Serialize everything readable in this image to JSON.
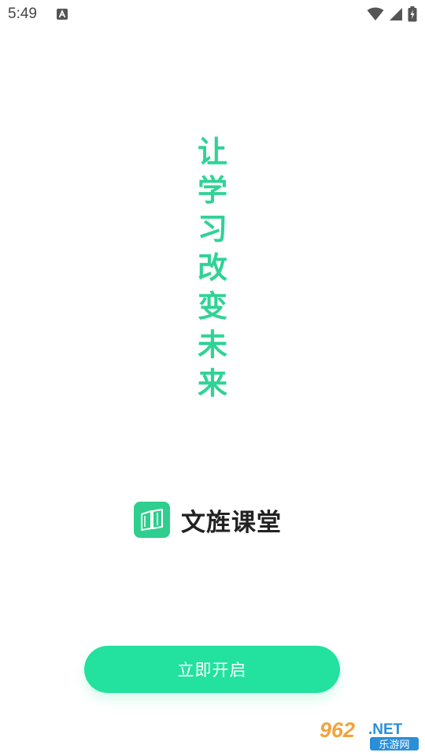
{
  "status_bar": {
    "time": "5:49",
    "notification_icon": "a-icon",
    "icons": [
      "wifi-icon",
      "signal-icon",
      "battery-charging-icon"
    ]
  },
  "slogan": {
    "chars": [
      "让",
      "学",
      "习",
      "改",
      "变",
      "未",
      "来"
    ]
  },
  "brand": {
    "name": "文旌课堂",
    "logo_icon": "book-icon"
  },
  "start_button": {
    "label": "立即开启"
  },
  "watermark": {
    "number": "962",
    "suffix": ".NET",
    "name": "乐游网"
  },
  "colors": {
    "accent": "#2fd395",
    "button": "#23e19f",
    "logo": "#2fce8e",
    "brand_text": "#222222"
  }
}
